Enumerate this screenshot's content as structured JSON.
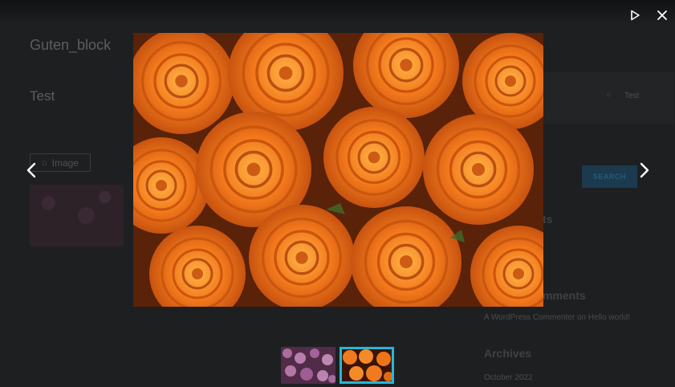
{
  "page": {
    "site_title": "Guten_block",
    "post_title": "Test",
    "image_block_label": "Image",
    "search_input_value": "Test",
    "search_button_label": "SEARCH",
    "recent_posts_heading_fragment": "ts",
    "recent_comments_heading_fragment": "mments",
    "comment_line": "A WordPress Commenter on Hello world!",
    "archives_heading": "Archives",
    "archive_month": "October 2022"
  },
  "lightbox": {
    "play_icon": "play-icon",
    "close_icon": "close-icon",
    "prev_icon": "chevron-left-icon",
    "next_icon": "chevron-right-icon",
    "current_slide": 2,
    "total_slides": 2,
    "thumbnails": [
      {
        "name": "purple flowers",
        "active": false
      },
      {
        "name": "orange roses",
        "active": true
      }
    ]
  },
  "colors": {
    "overlay": "#1e1f21",
    "accent": "#28b6d8",
    "icon": "#ffffff",
    "rose": "#f07a1f"
  }
}
